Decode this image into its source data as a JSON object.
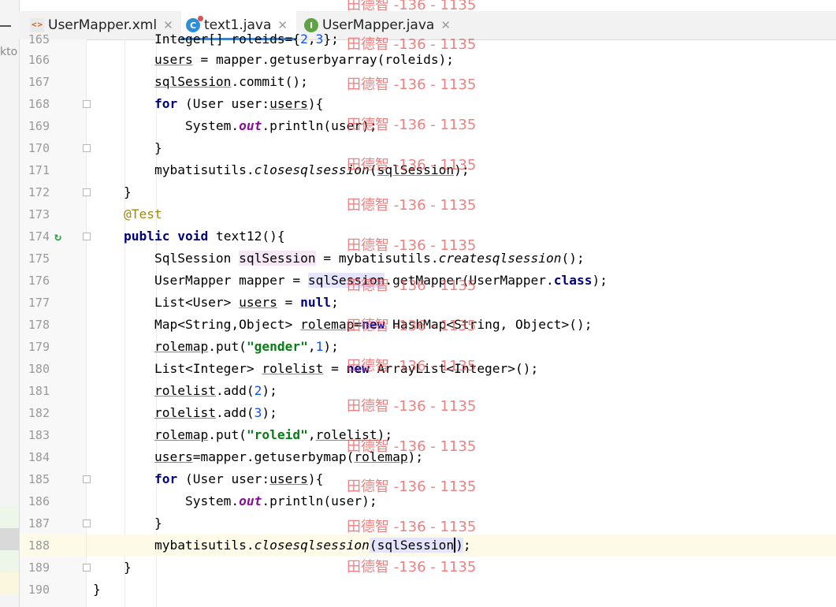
{
  "left_panel": {
    "peek_text": "kto"
  },
  "tabs": [
    {
      "label": "UserMapper.xml",
      "icon": "xml-file-icon",
      "active": false
    },
    {
      "label": "text1.java",
      "icon": "java-class-icon",
      "active": true
    },
    {
      "label": "UserMapper.java",
      "icon": "java-interface-icon",
      "active": false
    }
  ],
  "editor": {
    "lines": [
      {
        "num": "165",
        "code": "        Integer[] roleids={2,3};"
      },
      {
        "num": "166",
        "code": "        users = mapper.getuserbyarray(roleids);"
      },
      {
        "num": "167",
        "code": "        sqlSession.commit();"
      },
      {
        "num": "168",
        "code": "        for (User user:users){"
      },
      {
        "num": "169",
        "code": "            System.out.println(user);"
      },
      {
        "num": "170",
        "code": "        }"
      },
      {
        "num": "171",
        "code": "        mybatisutils.closesqlsession(sqlSession);"
      },
      {
        "num": "172",
        "code": "    }"
      },
      {
        "num": "173",
        "code": "    @Test"
      },
      {
        "num": "174",
        "code": "    public void text12(){"
      },
      {
        "num": "175",
        "code": "        SqlSession sqlSession = mybatisutils.createsqlsession();"
      },
      {
        "num": "176",
        "code": "        UserMapper mapper = sqlSession.getMapper(UserMapper.class);"
      },
      {
        "num": "177",
        "code": "        List<User> users = null;"
      },
      {
        "num": "178",
        "code": "        Map<String,Object> rolemap=new HashMap<String, Object>();"
      },
      {
        "num": "179",
        "code": "        rolemap.put(\"gender\",1);"
      },
      {
        "num": "180",
        "code": "        List<Integer> rolelist = new ArrayList<Integer>();"
      },
      {
        "num": "181",
        "code": "        rolelist.add(2);"
      },
      {
        "num": "182",
        "code": "        rolelist.add(3);"
      },
      {
        "num": "183",
        "code": "        rolemap.put(\"roleid\",rolelist);"
      },
      {
        "num": "184",
        "code": "        users=mapper.getuserbymap(rolemap);"
      },
      {
        "num": "185",
        "code": "        for (User user:users){"
      },
      {
        "num": "186",
        "code": "            System.out.println(user);"
      },
      {
        "num": "187",
        "code": "        }"
      },
      {
        "num": "188",
        "code": "        mybatisutils.closesqlsession(sqlSession);"
      },
      {
        "num": "189",
        "code": "    }"
      },
      {
        "num": "190",
        "code": "}"
      }
    ]
  },
  "watermark": "田德智 -136 - 1135",
  "colors": {
    "keyword": "#000080",
    "string": "#067d17",
    "number": "#1750eb",
    "annotation": "#9e880d",
    "static_field": "#871094",
    "current_line": "#fdfae8",
    "tab_underline": "#4083c9",
    "watermark": "#e85050"
  }
}
